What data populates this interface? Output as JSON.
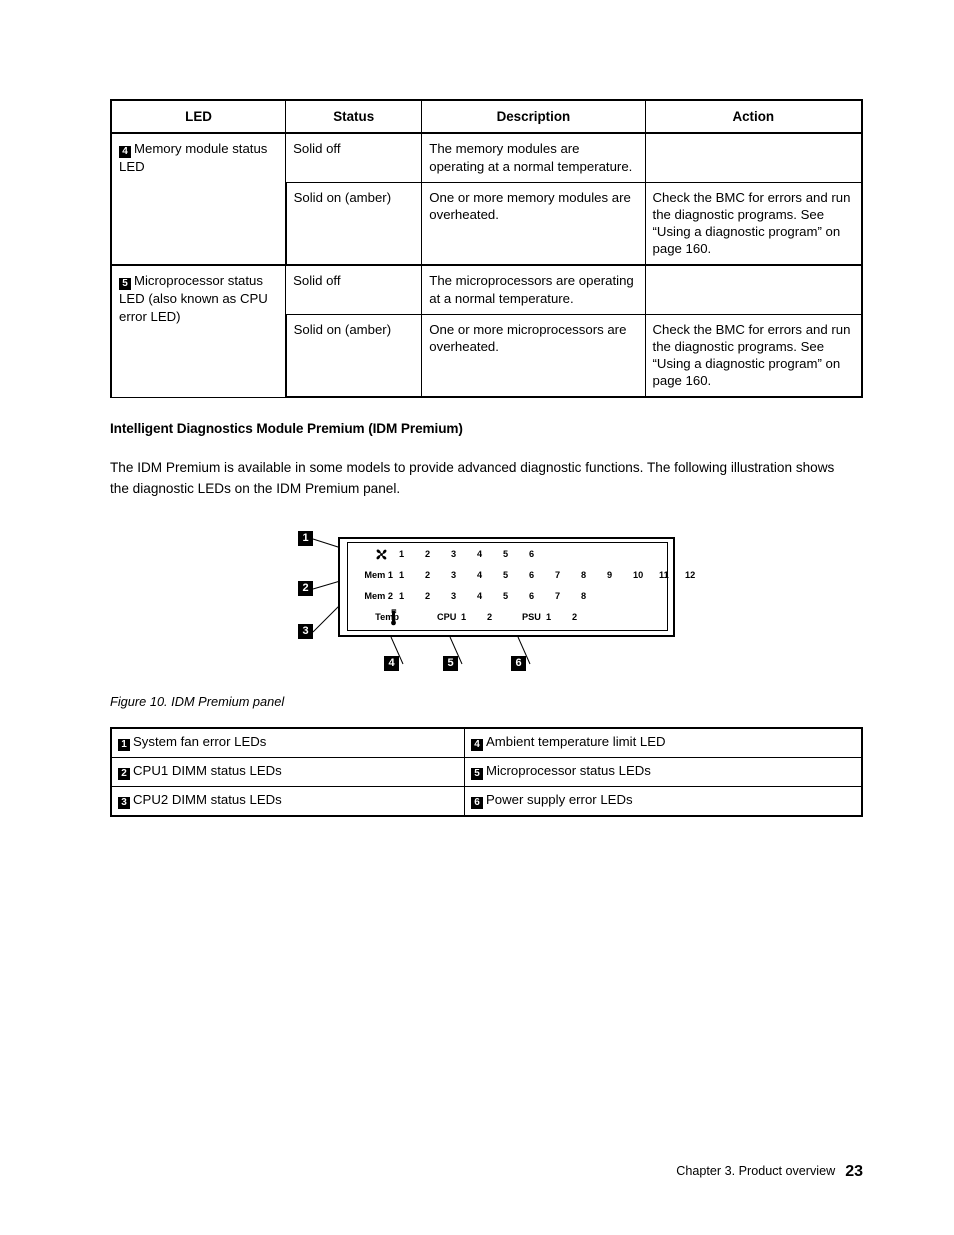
{
  "led_table": {
    "headers": [
      "LED",
      "Status",
      "Description",
      "Action"
    ],
    "rows": [
      {
        "badge": "4",
        "led": "Memory module status LED",
        "entries": [
          {
            "status": "Solid off",
            "description": "The memory modules are operating at a normal temperature.",
            "action": ""
          },
          {
            "status": "Solid on (amber)",
            "description": "One or more memory modules are overheated.",
            "action": "Check the BMC for errors and run the diagnostic programs. See “Using a diagnostic program” on page 160."
          }
        ]
      },
      {
        "badge": "5",
        "led": "Microprocessor status LED (also known as CPU error LED)",
        "entries": [
          {
            "status": "Solid off",
            "description": "The microprocessors are operating at a normal temperature.",
            "action": ""
          },
          {
            "status": "Solid on (amber)",
            "description": "One or more microprocessors are overheated.",
            "action": "Check the BMC for errors and run the diagnostic programs. See “Using a diagnostic program” on page 160."
          }
        ]
      }
    ]
  },
  "section": {
    "heading": "Intelligent Diagnostics Module Premium (IDM Premium)",
    "paragraph": "The IDM Premium is available in some models to provide advanced diagnostic functions. The following illustration shows the diagnostic LEDs on the IDM Premium panel."
  },
  "figure": {
    "caption": "Figure 10. IDM Premium panel",
    "panel": {
      "fan_row": {
        "icon": "fan-icon",
        "numbers": [
          "1",
          "2",
          "3",
          "4",
          "5",
          "6"
        ]
      },
      "mem1_row": {
        "label": "Mem 1",
        "numbers": [
          "1",
          "2",
          "3",
          "4",
          "5",
          "6",
          "7",
          "8",
          "9",
          "10",
          "11",
          "12"
        ]
      },
      "mem2_row": {
        "label": "Mem 2",
        "numbers": [
          "1",
          "2",
          "3",
          "4",
          "5",
          "6",
          "7",
          "8"
        ]
      },
      "temp_row": {
        "label": "Temp",
        "icon": "thermometer-icon",
        "cpu_label": "CPU",
        "cpu_numbers": [
          "1",
          "2"
        ],
        "psu_label": "PSU",
        "psu_numbers": [
          "1",
          "2"
        ]
      }
    },
    "callouts": [
      "1",
      "2",
      "3",
      "4",
      "5",
      "6"
    ]
  },
  "legend_table": {
    "rows": [
      {
        "left_badge": "1",
        "left_label": "System fan error LEDs",
        "right_badge": "4",
        "right_label": "Ambient temperature limit LED"
      },
      {
        "left_badge": "2",
        "left_label": "CPU1 DIMM status LEDs",
        "right_badge": "5",
        "right_label": "Microprocessor status LEDs"
      },
      {
        "left_badge": "3",
        "left_label": "CPU2 DIMM status LEDs",
        "right_badge": "6",
        "right_label": "Power supply error LEDs"
      }
    ]
  },
  "footer": {
    "chapter": "Chapter 3. Product overview",
    "page": "23"
  }
}
